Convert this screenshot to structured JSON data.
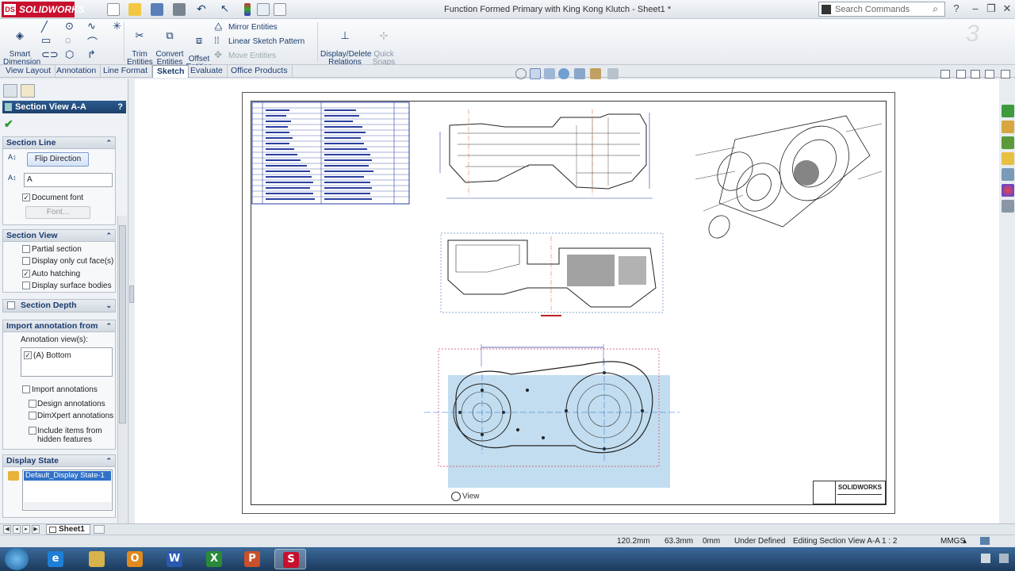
{
  "app": {
    "brand": "SOLIDWORKS",
    "brand_mark": "DS",
    "document_title": "Function Formed Primary with King Kong Klutch - Sheet1 *",
    "search_placeholder": "Search Commands"
  },
  "ribbon": {
    "smart_dimension": "Smart\nDimension",
    "trim_entities": "Trim\nEntities",
    "convert_entities": "Convert\nEntities",
    "offset_entities": "Offset\nEntities",
    "mirror_entities": "Mirror Entities",
    "linear_sketch_pattern": "Linear Sketch Pattern",
    "move_entities": "Move Entities",
    "display_delete_relations": "Display/Delete\nRelations",
    "quick_snaps": "Quick\nSnaps"
  },
  "tabs": [
    {
      "label": "View Layout",
      "active": false
    },
    {
      "label": "Annotation",
      "active": false
    },
    {
      "label": "Line Format",
      "active": false
    },
    {
      "label": "Sketch",
      "active": true
    },
    {
      "label": "Evaluate",
      "active": false
    },
    {
      "label": "Office Products",
      "active": false
    }
  ],
  "property_manager": {
    "title": "Section View A-A",
    "help": "?",
    "section_line": {
      "title": "Section Line",
      "flip_direction": "Flip Direction",
      "label_value": "A",
      "document_font": "Document font",
      "document_font_checked": true,
      "font_button": "Font..."
    },
    "section_view": {
      "title": "Section View",
      "options": [
        {
          "label": "Partial section",
          "checked": false
        },
        {
          "label": "Display only cut face(s)",
          "checked": false
        },
        {
          "label": "Auto hatching",
          "checked": true
        },
        {
          "label": "Display surface bodies",
          "checked": false
        }
      ]
    },
    "section_depth": {
      "title": "Section Depth",
      "checked": false
    },
    "import_annotation": {
      "title": "Import annotation from",
      "annotation_views_label": "Annotation view(s):",
      "views": [
        {
          "label": "(A) Bottom",
          "checked": true
        }
      ],
      "import_annotations": "Import annotations",
      "design_annotations": "Design annotations",
      "dimxpert_annotations": "DimXpert annotations",
      "include_hidden": "Include items from\nhidden features"
    },
    "display_state": {
      "title": "Display State",
      "selected": "Default_Display State-1"
    }
  },
  "canvas": {
    "view_label": "View",
    "title_block_logo": "SOLIDWORKS"
  },
  "sheet_tab": "Sheet1",
  "status": {
    "x": "120.2mm",
    "y": "63.3mm",
    "z": "0mm",
    "state": "Under Defined",
    "editing": "Editing Section View A-A",
    "scale": "1 : 2",
    "units": "MMGS"
  },
  "colors": {
    "accent": "#1a3b6e",
    "brand": "#c8102e",
    "selection": "#78b4dc"
  }
}
